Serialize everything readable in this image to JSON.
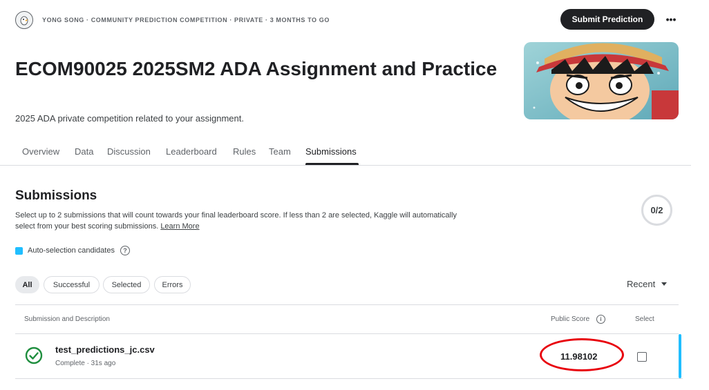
{
  "header": {
    "host_meta": "YONG SONG · COMMUNITY PREDICTION COMPETITION · PRIVATE · 3 MONTHS TO GO",
    "submit_label": "Submit Prediction",
    "more_label": "•••"
  },
  "competition": {
    "title": "ECOM90025 2025SM2 ADA Assignment and Practice",
    "subtitle": "2025 ADA private competition related to your assignment."
  },
  "tabs": [
    {
      "label": "Overview",
      "active": false
    },
    {
      "label": "Data",
      "active": false
    },
    {
      "label": "Discussion",
      "active": false
    },
    {
      "label": "Leaderboard",
      "active": false
    },
    {
      "label": "Rules",
      "active": false
    },
    {
      "label": "Team",
      "active": false
    },
    {
      "label": "Submissions",
      "active": true
    }
  ],
  "submissions": {
    "heading": "Submissions",
    "description": "Select up to 2 submissions that will count towards your final leaderboard score. If less than 2 are selected, Kaggle will automatically select from your best scoring submissions.",
    "learn_more": "Learn More",
    "counter": "0/2",
    "legend_label": "Auto-selection candidates",
    "legend_color": "#20beff",
    "help_glyph": "?",
    "filters": [
      {
        "label": "All",
        "active": true
      },
      {
        "label": "Successful",
        "active": false
      },
      {
        "label": "Selected",
        "active": false
      },
      {
        "label": "Errors",
        "active": false
      }
    ],
    "sort_label": "Recent",
    "columns": {
      "description": "Submission and Description",
      "public_score": "Public Score",
      "select": "Select"
    },
    "info_glyph": "i",
    "rows": [
      {
        "file_name": "test_predictions_jc.csv",
        "status_meta": "Complete · 31s ago",
        "public_score": "11.98102",
        "selected": false,
        "status_icon": "check-circle-icon",
        "highlight_color": "#e8000b"
      }
    ]
  },
  "colors": {
    "accent": "#20beff",
    "success": "#1e8e3e",
    "primary_button": "#202124"
  }
}
